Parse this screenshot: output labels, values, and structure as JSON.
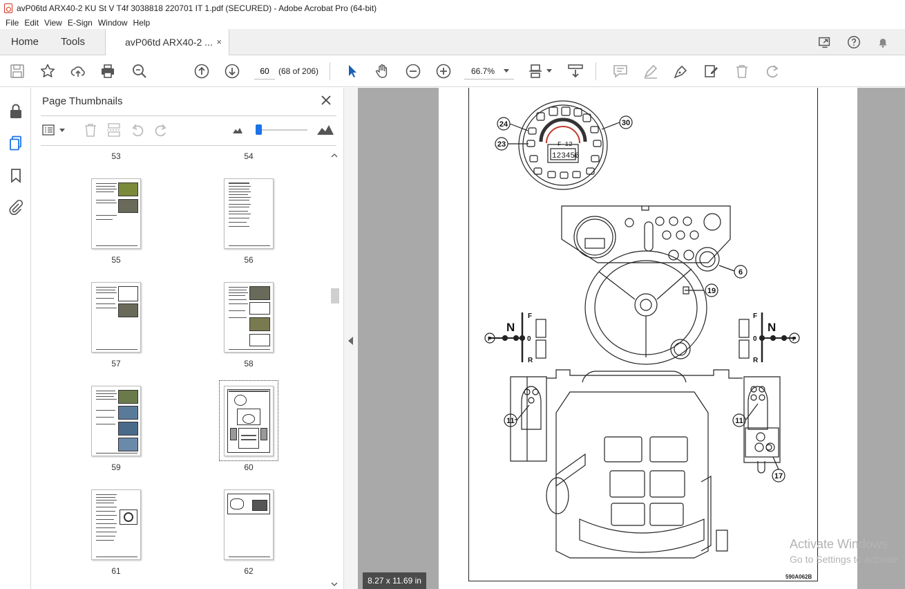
{
  "window": {
    "title": "avP06td ARX40-2 KU St V T4f 3038818 220701 IT 1.pdf (SECURED) - Adobe Acrobat Pro (64-bit)"
  },
  "menu": [
    "File",
    "Edit",
    "View",
    "E-Sign",
    "Window",
    "Help"
  ],
  "tabs": {
    "home": "Home",
    "tools": "Tools",
    "document": "avP06td ARX40-2 ...",
    "close": "×"
  },
  "toolbar": {
    "page_number": "60",
    "page_count": "(68 of 206)",
    "zoom": "66.7%"
  },
  "thumbnails": {
    "title": "Page Thumbnails",
    "pages": [
      {
        "label": "53"
      },
      {
        "label": "54"
      },
      {
        "label": "55"
      },
      {
        "label": "56"
      },
      {
        "label": "57"
      },
      {
        "label": "58"
      },
      {
        "label": "59"
      },
      {
        "label": "60"
      },
      {
        "label": "61"
      },
      {
        "label": "62"
      }
    ],
    "selected": "60"
  },
  "document": {
    "page_size": "8.27 x 11.69 in",
    "figure_code": "590A062B",
    "callouts": [
      "24",
      "30",
      "23",
      "6",
      "19",
      "11",
      "11",
      "17"
    ],
    "lever_labels": {
      "forward": "F",
      "neutral": "N",
      "reverse": "R",
      "zero": "0",
      "park": "P"
    },
    "display_text": {
      "gear": "F 12",
      "hours": "123456",
      "hours_unit": "h"
    }
  },
  "watermark": {
    "line1": "Activate Windows",
    "line2": "Go to Settings to activate"
  }
}
